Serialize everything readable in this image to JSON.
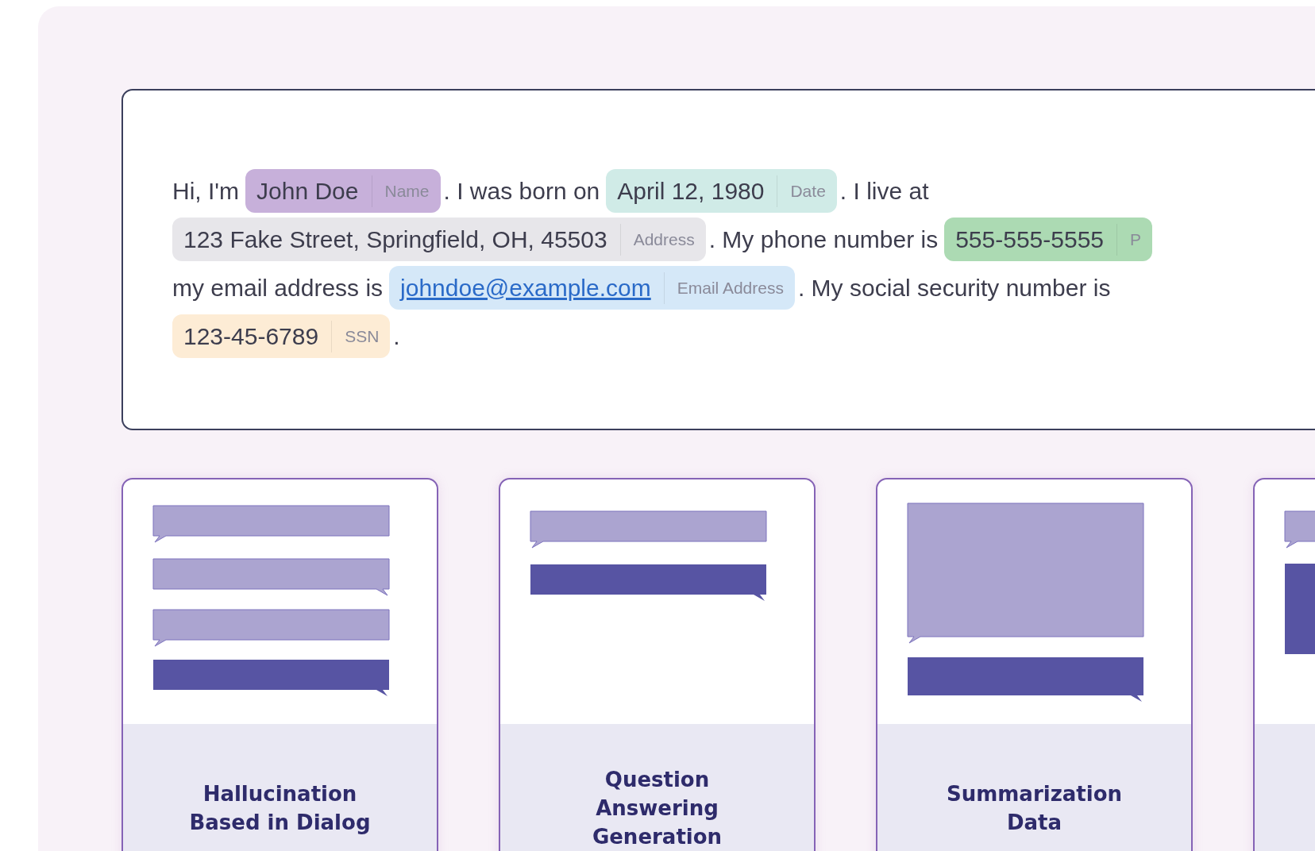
{
  "sentence": {
    "lines": [
      [
        {
          "kind": "text",
          "text": "Hi, I'm"
        },
        {
          "kind": "entity",
          "text": "John Doe",
          "label": "Name",
          "color": "#c7b0da"
        },
        {
          "kind": "text",
          "text": ". I was born on"
        },
        {
          "kind": "entity",
          "text": "April 12, 1980",
          "label": "Date",
          "color": "#d0ebe7"
        },
        {
          "kind": "text",
          "text": ". I live at"
        }
      ],
      [
        {
          "kind": "entity",
          "text": "123 Fake Street, Springfield, OH, 45503",
          "label": "Address",
          "color": "#e7e6ea"
        },
        {
          "kind": "text",
          "text": ". My phone number is"
        },
        {
          "kind": "entity",
          "text": "555-555-5555",
          "label": "P",
          "color": "#acdab3"
        }
      ],
      [
        {
          "kind": "text",
          "text": "my email address is"
        },
        {
          "kind": "link_entity",
          "text": "johndoe@example.com",
          "label": "Email Address",
          "color": "#d5e8f8"
        },
        {
          "kind": "text",
          "text": ". My social security number is"
        }
      ],
      [
        {
          "kind": "entity",
          "text": "123-45-6789",
          "label": "SSN",
          "color": "#fdecd5"
        },
        {
          "kind": "text",
          "text": "."
        }
      ]
    ]
  },
  "cards": [
    {
      "kind": "dialog",
      "title": "Hallucination Based in Dialog"
    },
    {
      "kind": "qa",
      "title": "Question Answering Generation"
    },
    {
      "kind": "summary",
      "title": "Summarization Data"
    },
    {
      "kind": "partial"
    }
  ]
}
